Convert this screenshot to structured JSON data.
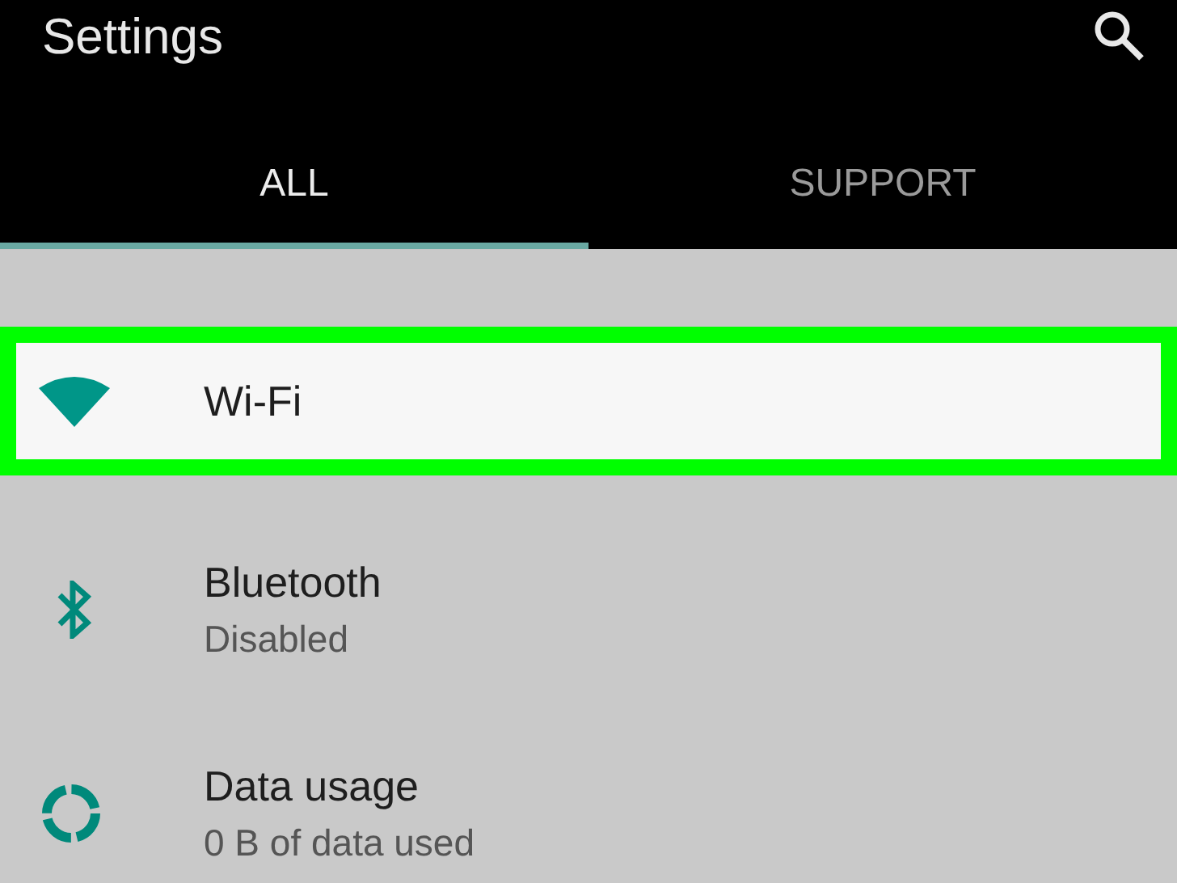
{
  "app_bar": {
    "title": "Settings"
  },
  "tabs": [
    {
      "label": "ALL",
      "selected": true
    },
    {
      "label": "SUPPORT",
      "selected": false
    }
  ],
  "items": [
    {
      "kind": "wifi",
      "title": "Wi-Fi",
      "highlighted": true
    },
    {
      "kind": "bluetooth",
      "title": "Bluetooth",
      "subtitle": "Disabled",
      "highlighted": false
    },
    {
      "kind": "data",
      "title": "Data usage",
      "subtitle": "0 B of data used",
      "highlighted": false
    }
  ]
}
